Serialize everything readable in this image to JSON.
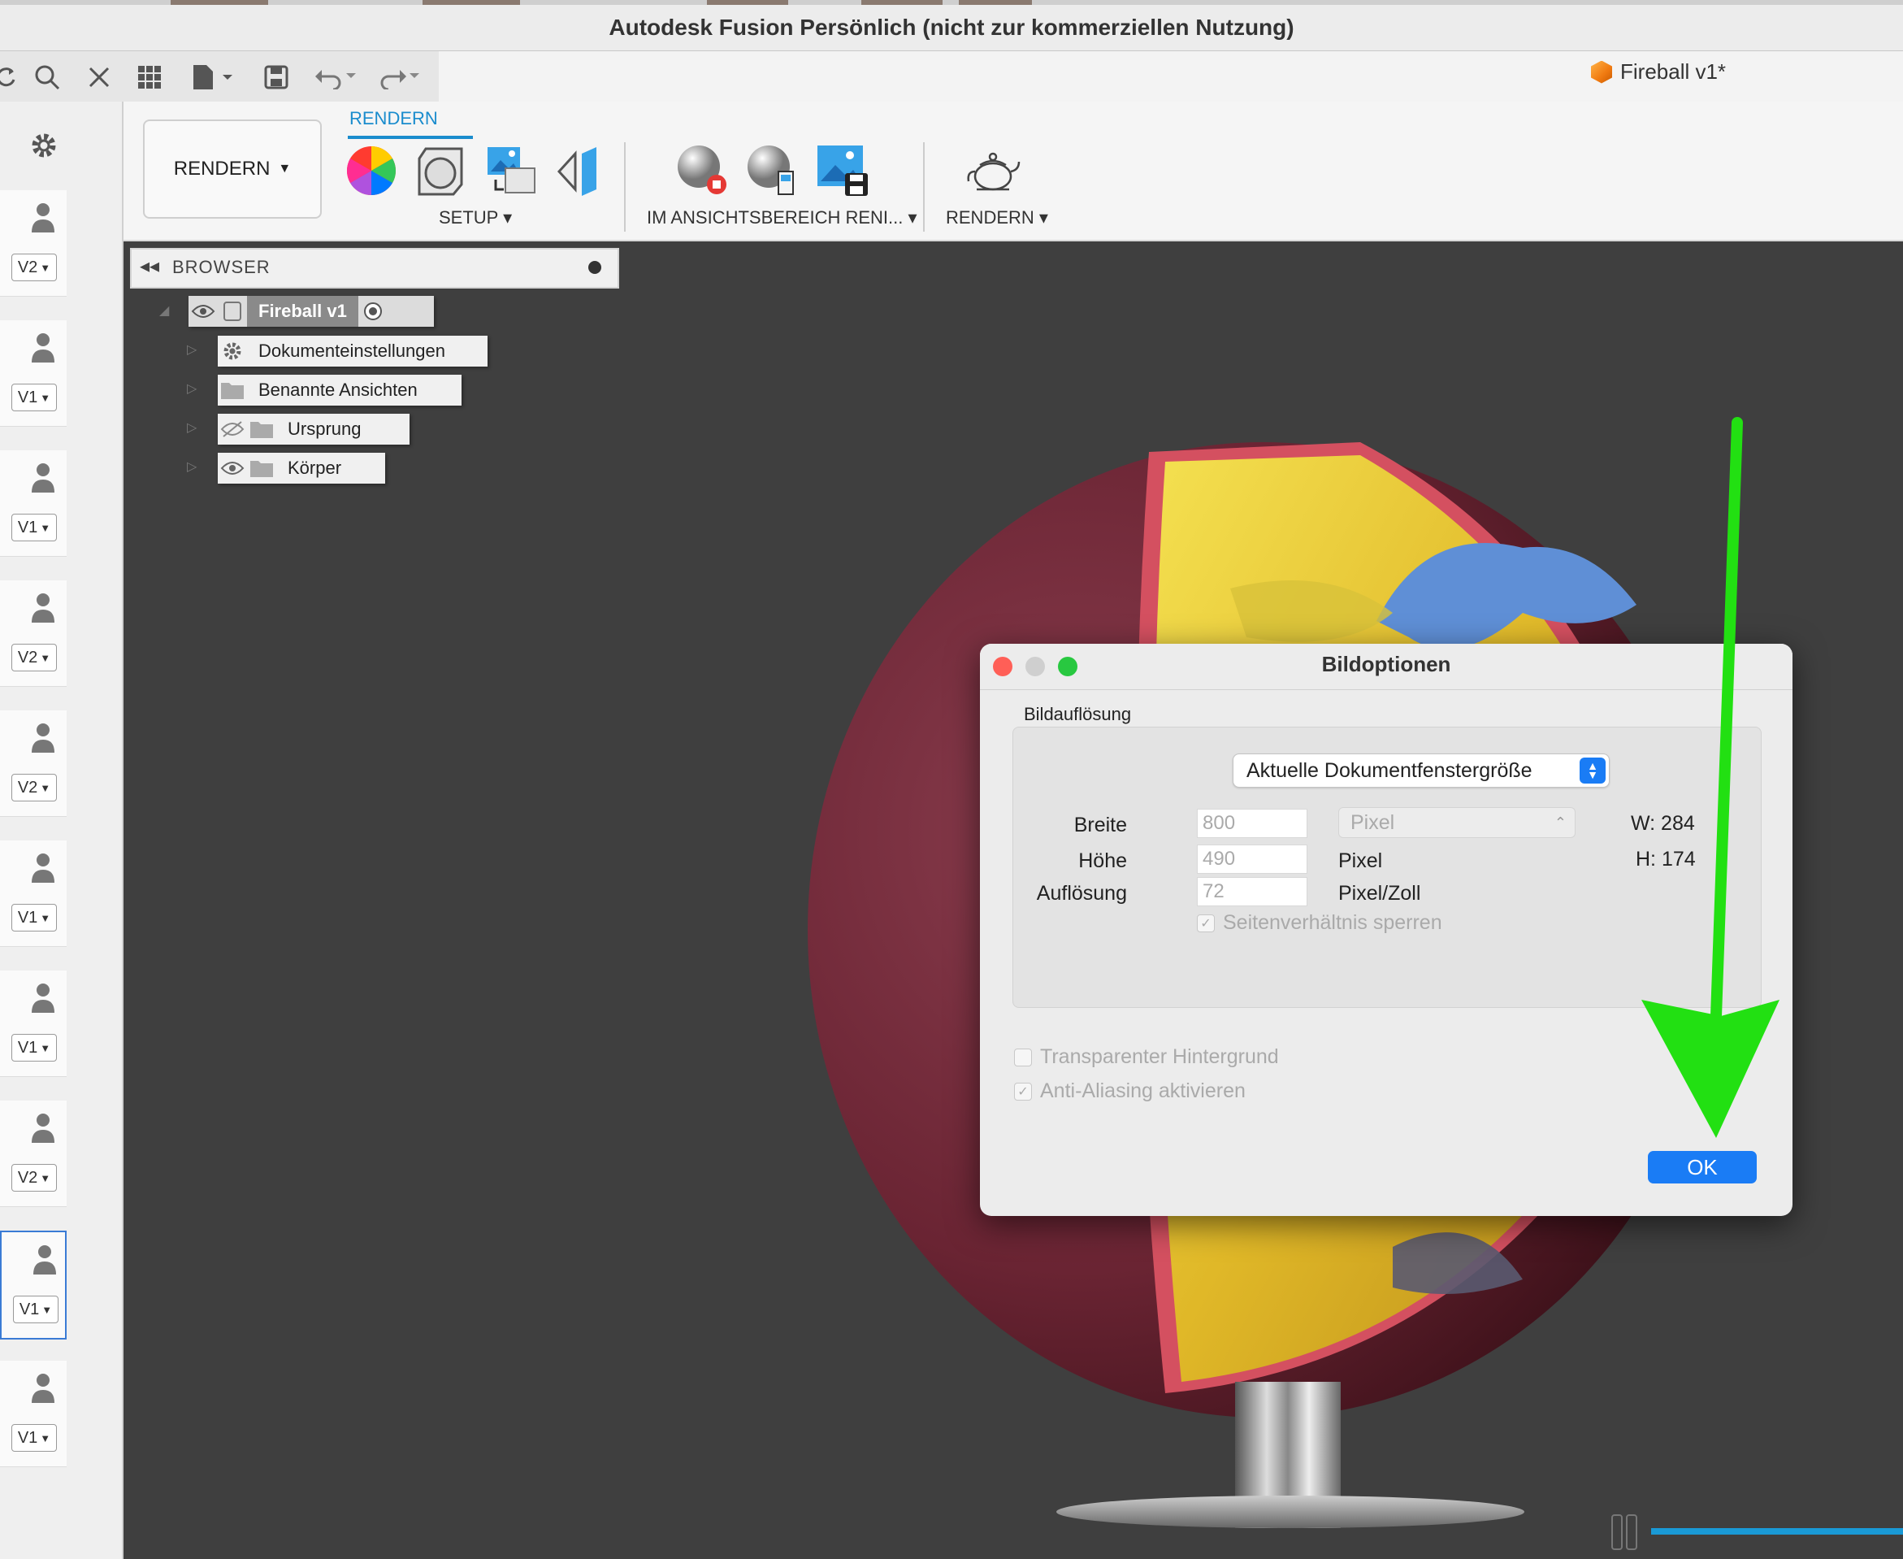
{
  "window": {
    "title": "Autodesk Fusion Persönlich (nicht zur kommerziellen Nutzung)"
  },
  "document_tab": {
    "label": "Fireball v1*"
  },
  "quick_access": [
    {
      "icon": "refresh-icon"
    },
    {
      "icon": "search-icon"
    },
    {
      "icon": "close-icon"
    },
    {
      "icon": "grid-icon"
    },
    {
      "icon": "file-icon"
    },
    {
      "icon": "save-icon"
    },
    {
      "icon": "undo-icon"
    },
    {
      "icon": "redo-icon"
    }
  ],
  "ribbon": {
    "workspace_button": "RENDERN",
    "active_tab": "RENDERN",
    "groups": [
      {
        "label": "SETUP"
      },
      {
        "label": "IM ANSICHTSBEREICH RENI..."
      },
      {
        "label": "RENDERN"
      }
    ]
  },
  "versions": [
    "V2",
    "V1",
    "V1",
    "V2",
    "V2",
    "V1",
    "V1",
    "V2",
    "V1",
    "V1"
  ],
  "browser": {
    "title": "BROWSER",
    "root": "Fireball v1",
    "items": [
      {
        "label": "Dokumenteinstellungen"
      },
      {
        "label": "Benannte Ansichten"
      },
      {
        "label": "Ursprung"
      },
      {
        "label": "Körper"
      }
    ]
  },
  "dialog": {
    "title": "Bildoptionen",
    "group_label": "Bildauflösung",
    "size_option": "Aktuelle Dokumentfenstergröße",
    "width_label": "Breite",
    "width_value": "800",
    "width_unit": "Pixel",
    "width_readout": "W: 284",
    "height_label": "Höhe",
    "height_value": "490",
    "height_unit": "Pixel",
    "height_readout": "H: 174",
    "resolution_label": "Auflösung",
    "resolution_value": "72",
    "resolution_unit": "Pixel/Zoll",
    "lock_aspect": "Seitenverhältnis sperren",
    "transparent_bg": "Transparenter Hintergrund",
    "anti_aliasing": "Anti-Aliasing aktivieren",
    "ok_label": "OK"
  },
  "colors": {
    "accent": "#1a7cf5",
    "tab_blue": "#1a8ccd",
    "arrow_green": "#22e012",
    "sphere_red": "#8a2c3c"
  }
}
